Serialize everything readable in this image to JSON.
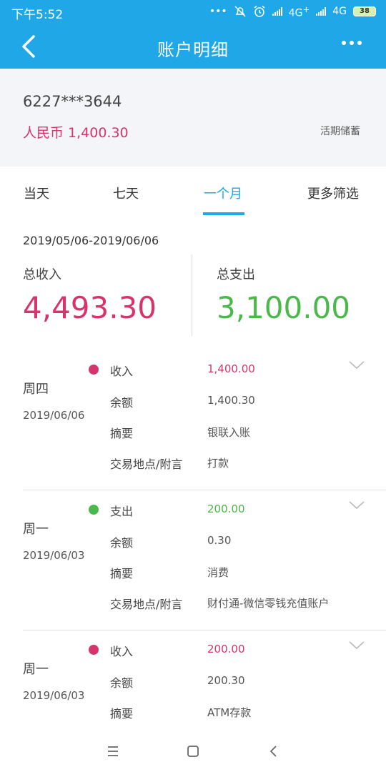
{
  "status": {
    "time": "下午5:52",
    "dots": "•••",
    "net1": "4G",
    "net1_sup": "+",
    "net2": "4G",
    "battery": "38"
  },
  "header": {
    "title": "账户明细"
  },
  "account": {
    "card_number": "6227***3644",
    "balance": "人民币 1,400.30",
    "type": "活期储蓄"
  },
  "tabs": [
    {
      "label": "当天",
      "active": false
    },
    {
      "label": "七天",
      "active": false
    },
    {
      "label": "一个月",
      "active": true
    },
    {
      "label": "更多筛选",
      "active": false
    }
  ],
  "summary": {
    "range": "2019/05/06-2019/06/06",
    "income_label": "总收入",
    "income_value": "4,493.30",
    "expense_label": "总支出",
    "expense_value": "3,100.00"
  },
  "colors": {
    "accent": "#1fa7e8",
    "income": "#d6346b",
    "expense": "#4ab84a"
  },
  "transactions": [
    {
      "day": "周四",
      "date": "2019/06/06",
      "kind": "income",
      "type_label": "收入",
      "amount": "1,400.00",
      "balance_label": "余额",
      "balance": "1,400.30",
      "summary_label": "摘要",
      "summary": "银联入账",
      "place_label": "交易地点/附言",
      "place": "打款"
    },
    {
      "day": "周一",
      "date": "2019/06/03",
      "kind": "expense",
      "type_label": "支出",
      "amount": "200.00",
      "balance_label": "余额",
      "balance": "0.30",
      "summary_label": "摘要",
      "summary": "消费",
      "place_label": "交易地点/附言",
      "place": "财付通-微信零钱充值账户"
    },
    {
      "day": "周一",
      "date": "2019/06/03",
      "kind": "income",
      "type_label": "收入",
      "amount": "200.00",
      "balance_label": "余额",
      "balance": "200.30",
      "summary_label": "摘要",
      "summary": "ATM存款"
    }
  ],
  "icons": {
    "back": "chevron-left-icon",
    "more": "more-dots-icon",
    "expand": "chevron-down-icon",
    "menu": "menu-icon",
    "home": "home-square-icon",
    "nav_back": "nav-back-icon"
  }
}
